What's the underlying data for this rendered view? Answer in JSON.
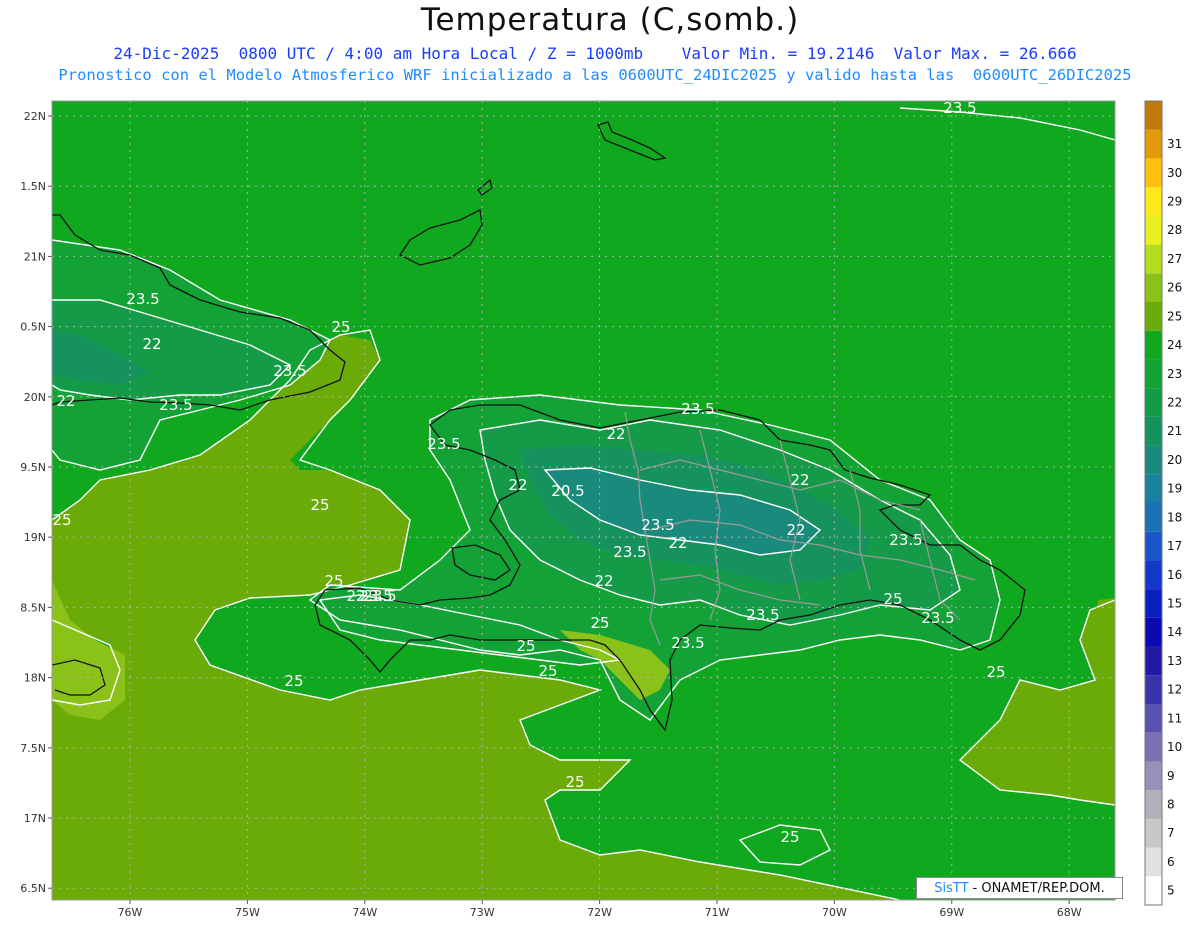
{
  "title": "Temperatura (C,somb.)",
  "subtitle1": "24-Dic-2025  0800 UTC / 4:00 am Hora Local / Z = 1000mb    Valor Min. = 19.2146  Valor Max. = 26.666",
  "subtitle2": "Pronostico con el Modelo Atmosferico WRF inicializado a las 0600UTC_24DIC2025 y valido hasta las  0600UTC_26DIC2025",
  "credit": {
    "logo": "SisTT",
    "text": "- ONAMET/REP.DOM."
  },
  "chart_data": {
    "type": "heatmap",
    "variable": "Temperatura (C,somb.)",
    "level": "1000mb",
    "valid_time": "24-Dic-2025 0800 UTC",
    "min": 19.2146,
    "max": 26.666,
    "lat_range": [
      16.5,
      22.1
    ],
    "lon_range": [
      -76.6,
      -67.6
    ],
    "lat_ticks": [
      "22N",
      "1.5N",
      "21N",
      "0.5N",
      "20N",
      "9.5N",
      "19N",
      "8.5N",
      "18N",
      "7.5N",
      "17N",
      "6.5N"
    ],
    "lon_ticks": [
      "76W",
      "75W",
      "74W",
      "73W",
      "72W",
      "71W",
      "70W",
      "69W",
      "68W"
    ],
    "colorbar": [
      {
        "value": "5",
        "color": "#ffffff"
      },
      {
        "value": "6",
        "color": "#e0e0e0"
      },
      {
        "value": "7",
        "color": "#c8c8c8"
      },
      {
        "value": "8",
        "color": "#b0b0b8"
      },
      {
        "value": "9",
        "color": "#9890b8"
      },
      {
        "value": "10",
        "color": "#7a72b4"
      },
      {
        "value": "11",
        "color": "#5a52b0"
      },
      {
        "value": "12",
        "color": "#3a34aa"
      },
      {
        "value": "13",
        "color": "#1e1aa6"
      },
      {
        "value": "14",
        "color": "#0a0ab0"
      },
      {
        "value": "15",
        "color": "#0a1fc0"
      },
      {
        "value": "16",
        "color": "#1438c8"
      },
      {
        "value": "17",
        "color": "#1a55c8"
      },
      {
        "value": "18",
        "color": "#1a70b4"
      },
      {
        "value": "19",
        "color": "#1a80a0"
      },
      {
        "value": "20",
        "color": "#1a8a7c"
      },
      {
        "value": "21",
        "color": "#16925e"
      },
      {
        "value": "22",
        "color": "#159a48"
      },
      {
        "value": "23",
        "color": "#12a236"
      },
      {
        "value": "24",
        "color": "#0fa81e"
      },
      {
        "value": "25",
        "color": "#6aab08"
      },
      {
        "value": "26",
        "color": "#8ac21a"
      },
      {
        "value": "27",
        "color": "#b6dc22"
      },
      {
        "value": "28",
        "color": "#e8f020"
      },
      {
        "value": "29",
        "color": "#ffe81a"
      },
      {
        "value": "30",
        "color": "#ffc010"
      },
      {
        "value": "31",
        "color": "#e09a0a"
      },
      {
        "value": "",
        "color": "#c07a08"
      }
    ],
    "contour_labels": [
      "23.5",
      "23.5",
      "22",
      "23.5",
      "22",
      "23.5",
      "25",
      "25",
      "23.5",
      "22",
      "22",
      "20.5",
      "23.5",
      "22",
      "22",
      "22",
      "23.5",
      "23.5",
      "22",
      "23.5",
      "23.5",
      "25",
      "23.5",
      "25",
      "23.5",
      "25",
      "25",
      "25",
      "25",
      "25",
      "23.5",
      "22",
      "23.5",
      "25",
      "25",
      "25"
    ]
  }
}
